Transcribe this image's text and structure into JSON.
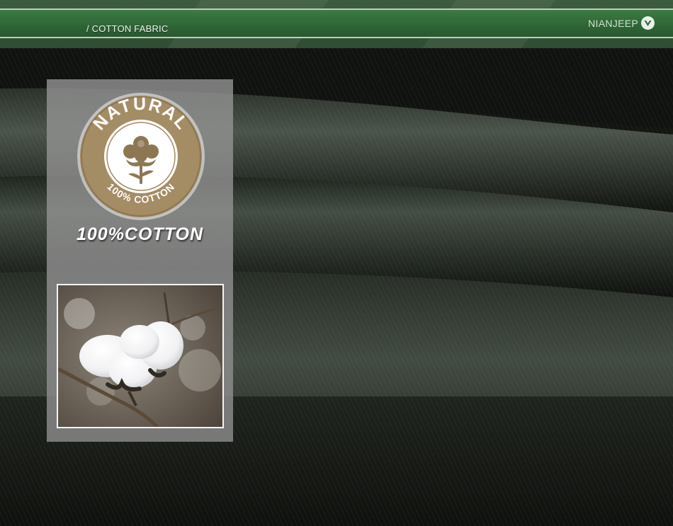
{
  "header": {
    "breadcrumb": "/ COTTON FABRIC",
    "brand": "NIANJEEP"
  },
  "badge": {
    "top_text": "NATURAL",
    "bottom_text": "100% COTTON"
  },
  "panel": {
    "heading": "100%COTTON"
  },
  "icons": {
    "brand_logo": "shield-triangle-icon",
    "cotton_flower": "cotton-flower-icon"
  },
  "colors": {
    "header_green": "#2f6a37",
    "fabric_dark": "#121510",
    "badge_gold": "#a18a63"
  }
}
